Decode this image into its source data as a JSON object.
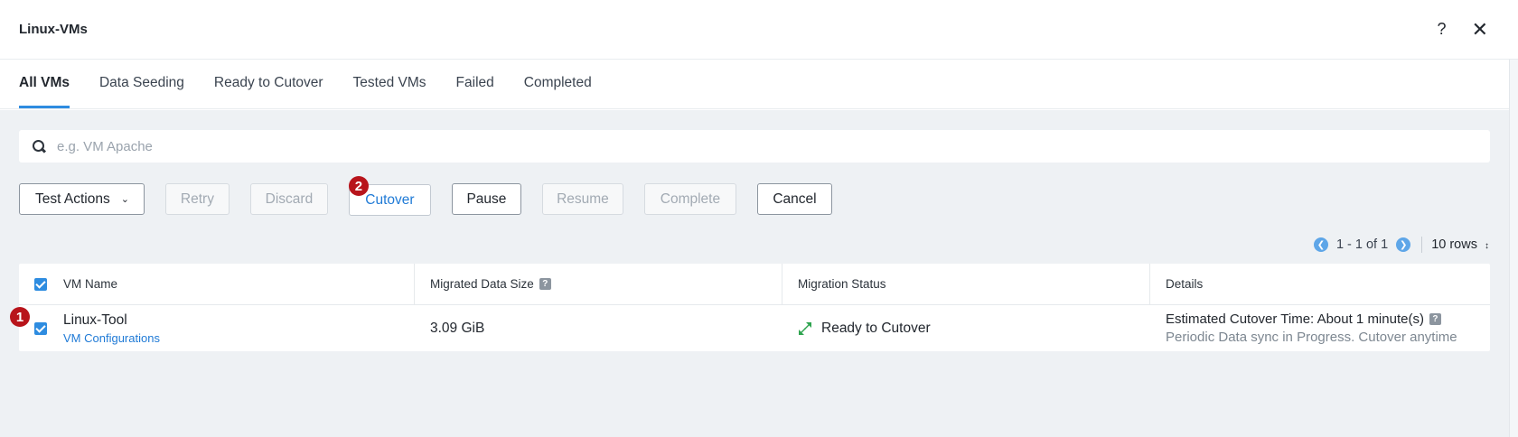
{
  "window": {
    "title": "Linux-VMs",
    "help_label": "?",
    "close_label": "✕"
  },
  "tabs": [
    {
      "label": "All VMs",
      "active": true
    },
    {
      "label": "Data Seeding"
    },
    {
      "label": "Ready to Cutover"
    },
    {
      "label": "Tested VMs"
    },
    {
      "label": "Failed"
    },
    {
      "label": "Completed"
    }
  ],
  "search": {
    "icon": "search-icon",
    "placeholder": "e.g. VM Apache",
    "value": ""
  },
  "toolbar": {
    "test_actions_label": "Test Actions",
    "retry_label": "Retry",
    "discard_label": "Discard",
    "cutover_label": "Cutover",
    "pause_label": "Pause",
    "resume_label": "Resume",
    "complete_label": "Complete",
    "cancel_label": "Cancel",
    "cutover_step_badge": "2"
  },
  "pagination": {
    "range": "1 - 1 of 1",
    "rows_label": "10 rows"
  },
  "table": {
    "headers": {
      "vm_name": "VM Name",
      "migrated_data_size": "Migrated Data Size",
      "migration_status": "Migration Status",
      "details": "Details"
    },
    "help_label": "?",
    "rows": [
      {
        "step_badge": "1",
        "vm_name": "Linux-Tool",
        "vm_link": "VM Configurations",
        "migrated_data_size": "3.09 GiB",
        "migration_status": "Ready to Cutover",
        "details_line1": "Estimated Cutover Time: About 1 minute(s)",
        "details_line2": "Periodic Data sync in Progress. Cutover anytime"
      }
    ]
  },
  "colors": {
    "accent": "#2e8ce0",
    "link": "#1f7ad6",
    "badge": "#b8141b",
    "status_ready": "#2ea44f"
  }
}
